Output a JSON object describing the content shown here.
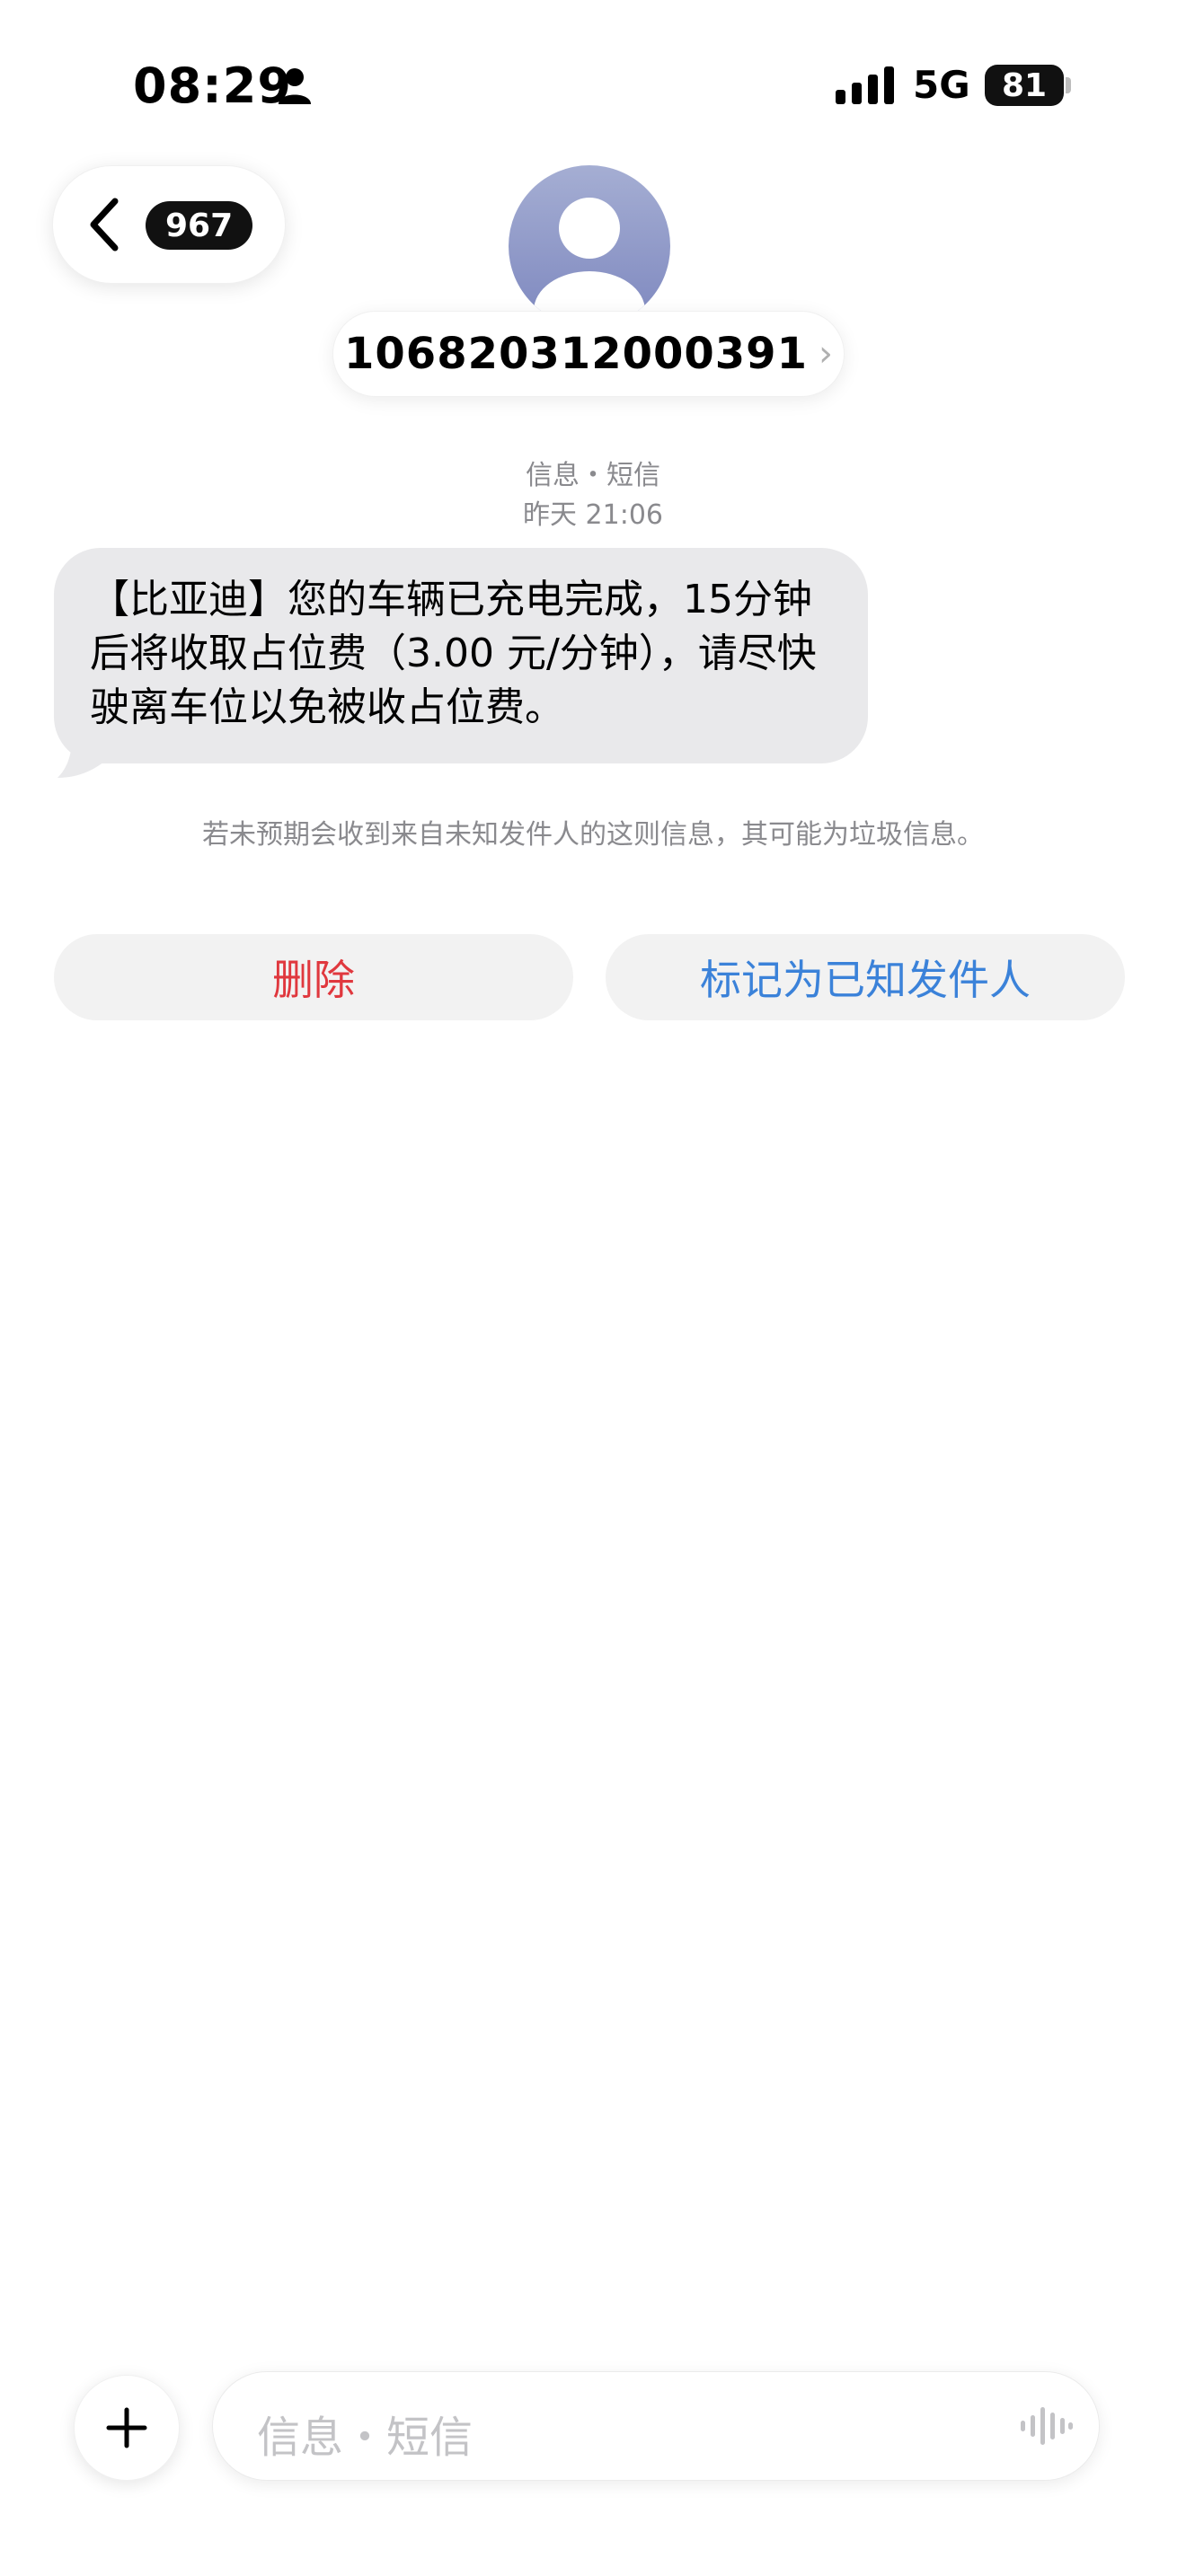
{
  "status_bar": {
    "time": "08:29",
    "network": "5G",
    "battery": "81"
  },
  "header": {
    "unread_count": "967",
    "contact_number": "106820312000391",
    "contact_chevron": "›"
  },
  "conversation": {
    "service_label": "信息・短信",
    "timestamp": "昨天 21:06",
    "message": "【比亚迪】您的车辆已充电完成，15分钟后将收取占位费（3.00 元/分钟），请尽快驶离车位以免被收占位费。",
    "notice": "若未预期会收到来自未知发件人的这则信息，其可能为垃圾信息。"
  },
  "actions": {
    "delete_label": "删除",
    "mark_known_label": "标记为已知发件人"
  },
  "composer": {
    "placeholder": "信息・短信"
  }
}
